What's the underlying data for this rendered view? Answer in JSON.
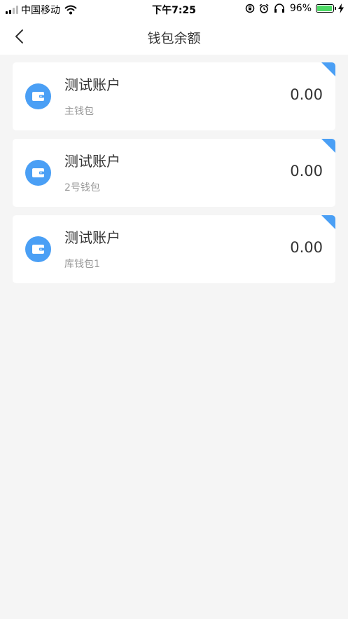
{
  "status_bar": {
    "carrier": "中国移动",
    "time": "下午7:25",
    "battery": "96%"
  },
  "nav": {
    "title": "钱包余额"
  },
  "wallets": [
    {
      "name": "测试账户",
      "sub": "主钱包",
      "amount": "0.00"
    },
    {
      "name": "测试账户",
      "sub": "2号钱包",
      "amount": "0.00"
    },
    {
      "name": "测试账户",
      "sub": "库钱包1",
      "amount": "0.00"
    }
  ],
  "colors": {
    "accent": "#4a9ff5",
    "background": "#f5f5f5",
    "battery": "#4cd964"
  },
  "icons": {
    "back": "chevron-left-icon",
    "wallet": "wallet-icon",
    "wifi": "wifi-icon",
    "alarm": "alarm-icon",
    "headphones": "headphones-icon",
    "rotation_lock": "rotation-lock-icon",
    "charging": "lightning-icon"
  }
}
